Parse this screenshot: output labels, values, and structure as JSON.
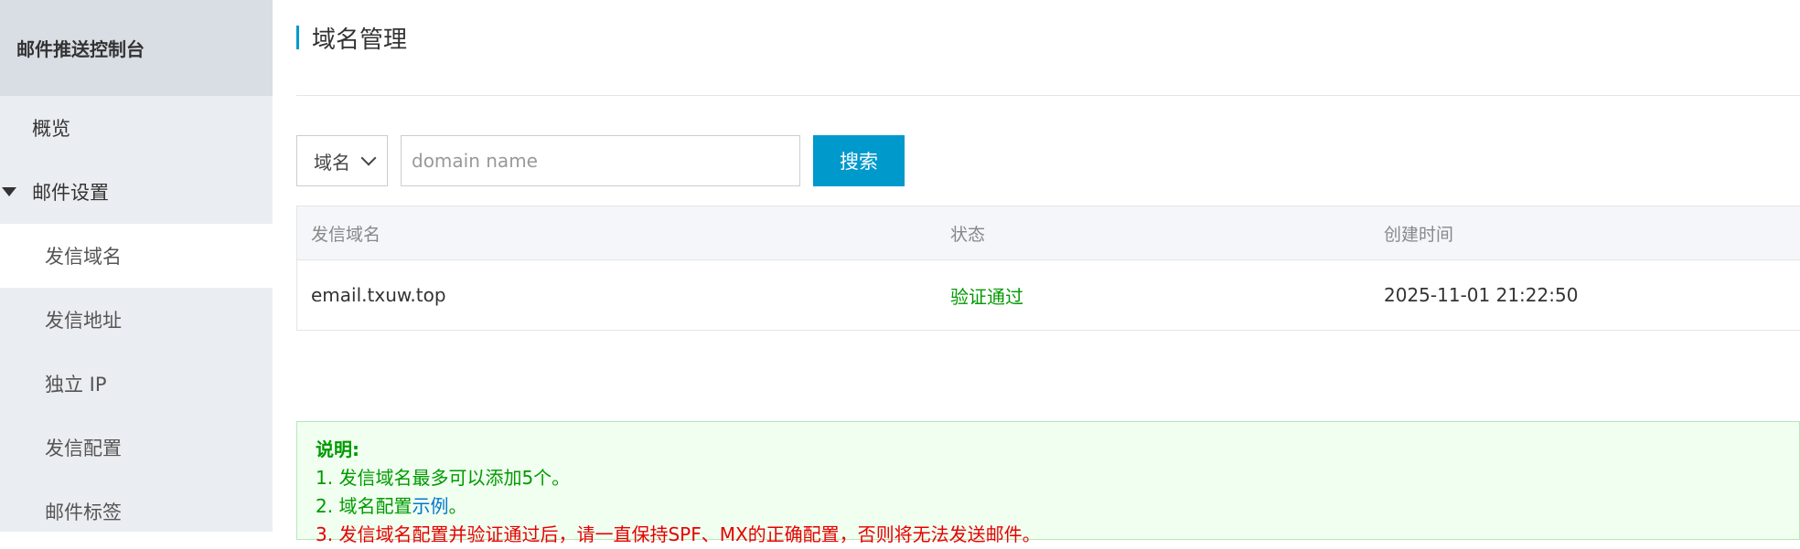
{
  "sidebar": {
    "header": "邮件推送控制台",
    "items": [
      {
        "label": "概览"
      },
      {
        "label": "邮件设置"
      },
      {
        "label": "发信域名"
      },
      {
        "label": "发信地址"
      },
      {
        "label": "独立 IP"
      },
      {
        "label": "发信配置"
      },
      {
        "label": "邮件标签"
      }
    ]
  },
  "page": {
    "title": "域名管理"
  },
  "search": {
    "select_value": "域名",
    "placeholder": "domain name",
    "button_label": "搜索"
  },
  "table": {
    "columns": [
      "发信域名",
      "状态",
      "创建时间"
    ],
    "rows": [
      {
        "domain": "email.txuw.top",
        "status": "验证通过",
        "created": "2025-11-01 21:22:50"
      }
    ]
  },
  "notice": {
    "title": "说明:",
    "line1": "1. 发信域名最多可以添加5个。",
    "line2_prefix": "2. 域名配置",
    "line2_link": "示例",
    "line2_suffix": "。",
    "line3": "3. 发信域名配置并验证通过后，请一直保持SPF、MX的正确配置，否则将无法发送邮件。"
  },
  "colors": {
    "accent": "#0099cc",
    "success": "#009900",
    "warning": "#e60000",
    "sidebar_bg": "#eaedf1"
  }
}
